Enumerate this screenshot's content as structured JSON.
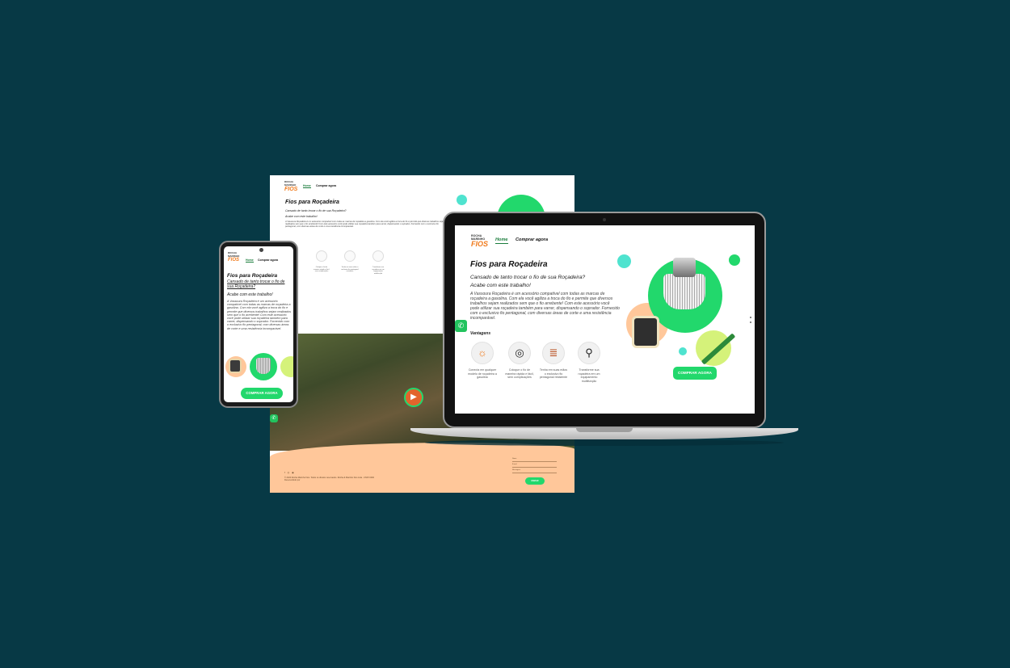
{
  "colors": {
    "background": "#073945",
    "accent_green": "#22d86c",
    "brand_orange": "#f07a1c",
    "peach": "#ffc79a",
    "cyan": "#4fe3cf",
    "lime": "#d5f27a"
  },
  "site": {
    "logo_line1": "ROCHA",
    "logo_line2": "MARINHO",
    "logo_brand": "FIOS",
    "nav": {
      "home": "Home",
      "buy": "Comprar agora"
    },
    "title": "Fios para Roçadeira",
    "subtitle": "Cansado de tanto trocar o fio de sua Roçadeira?",
    "subtitle2": "Acabe com este trabalho!",
    "body": "A Vassoura Roçadeira é um acessório compatível com todas as marcas de roçadeira a gasolina. Com ela você agiliza a troca do fio e permite que diversos trabalhos sejam realizados sem que o fio arrebente! Com este acessório você pode utilizar sua roçadeira também para varrer, dispensando o soprador. Fornecido com o exclusivo fio pentagonal, com diversas áreas de corte e uma resistência incomparável.",
    "advantages_heading": "Vantagens",
    "advantages": [
      {
        "icon": "sun-burst-icon",
        "glyph": "☼",
        "text": "Conecta em qualquer modelo de roçadeira a gasolina"
      },
      {
        "icon": "spiral-icon",
        "glyph": "◎",
        "text": "Coloque o fio de maneira rápida e fácil, sem complicações"
      },
      {
        "icon": "pentagon-line-icon",
        "glyph": "≣",
        "text": "Tenha em suas mãos o exclusivo fio pentagonal resistente"
      },
      {
        "icon": "trimmer-tool-icon",
        "glyph": "⚲",
        "text": "Transforme sua roçadeira em um equipamento multifunção"
      }
    ],
    "cta": "COMPRAR AGORA",
    "whatsapp_glyph": "✆",
    "play_glyph": "▶"
  },
  "footer": {
    "social": "f ◎ ◉",
    "copyright": "© 2020 Rocha Marinho Fios. Todos os direitos reservados. Rocha & Marinho Fios Ltda - CNPJ 0000",
    "credit": "Desenvolvido por",
    "field_labels": [
      "Nome",
      "E-mail",
      "Mensagem"
    ],
    "submit": "ENVIAR"
  }
}
